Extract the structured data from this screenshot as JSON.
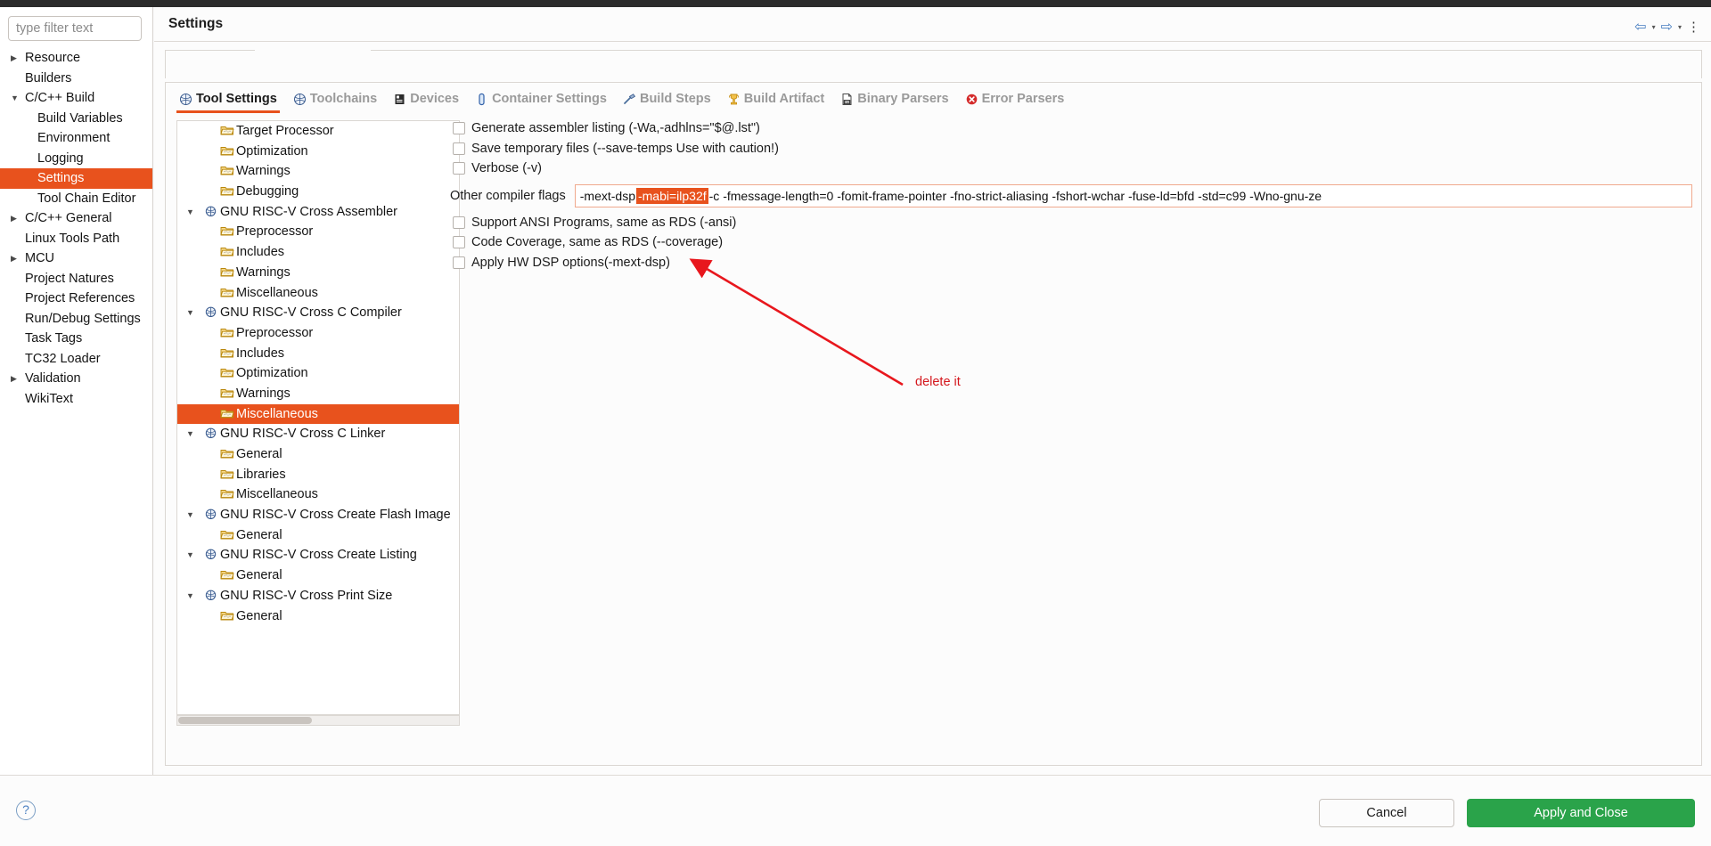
{
  "window": {
    "title": "Settings"
  },
  "sidebar": {
    "filter_placeholder": "type filter text",
    "items": [
      {
        "label": "Resource",
        "twisty": "collapsed",
        "indent": 0,
        "selected": false
      },
      {
        "label": "Builders",
        "twisty": "none",
        "indent": 0,
        "selected": false
      },
      {
        "label": "C/C++ Build",
        "twisty": "expanded",
        "indent": 0,
        "selected": false
      },
      {
        "label": "Build Variables",
        "twisty": "none",
        "indent": 1,
        "selected": false
      },
      {
        "label": "Environment",
        "twisty": "none",
        "indent": 1,
        "selected": false
      },
      {
        "label": "Logging",
        "twisty": "none",
        "indent": 1,
        "selected": false
      },
      {
        "label": "Settings",
        "twisty": "none",
        "indent": 1,
        "selected": true
      },
      {
        "label": "Tool Chain Editor",
        "twisty": "none",
        "indent": 1,
        "selected": false
      },
      {
        "label": "C/C++ General",
        "twisty": "collapsed",
        "indent": 0,
        "selected": false
      },
      {
        "label": "Linux Tools Path",
        "twisty": "none",
        "indent": 0,
        "selected": false
      },
      {
        "label": "MCU",
        "twisty": "collapsed",
        "indent": 0,
        "selected": false
      },
      {
        "label": "Project Natures",
        "twisty": "none",
        "indent": 0,
        "selected": false
      },
      {
        "label": "Project References",
        "twisty": "none",
        "indent": 0,
        "selected": false
      },
      {
        "label": "Run/Debug Settings",
        "twisty": "none",
        "indent": 0,
        "selected": false
      },
      {
        "label": "Task Tags",
        "twisty": "none",
        "indent": 0,
        "selected": false
      },
      {
        "label": "TC32 Loader",
        "twisty": "none",
        "indent": 0,
        "selected": false
      },
      {
        "label": "Validation",
        "twisty": "collapsed",
        "indent": 0,
        "selected": false
      },
      {
        "label": "WikiText",
        "twisty": "none",
        "indent": 0,
        "selected": false
      }
    ]
  },
  "header": {
    "title": "Settings",
    "nav_back": "⇦",
    "nav_back_caret": "▾",
    "nav_forward": "⇨",
    "nav_forward_caret": "▾",
    "menu": "⋮"
  },
  "tabs": [
    {
      "label": "Tool Settings",
      "icon": "wrench-gear-icon",
      "active": true
    },
    {
      "label": "Toolchains",
      "icon": "wrench-gear-icon",
      "active": false
    },
    {
      "label": "Devices",
      "icon": "chip-icon",
      "active": false
    },
    {
      "label": "Container Settings",
      "icon": "container-icon",
      "active": false
    },
    {
      "label": "Build Steps",
      "icon": "hammer-icon",
      "active": false
    },
    {
      "label": "Build Artifact",
      "icon": "trophy-icon",
      "active": false
    },
    {
      "label": "Binary Parsers",
      "icon": "binary-file-icon",
      "active": false
    },
    {
      "label": "Error Parsers",
      "icon": "error-circle-icon",
      "active": false
    }
  ],
  "tool_tree": [
    {
      "label": "Target Processor",
      "twisty": "none",
      "level": 1,
      "selected": false
    },
    {
      "label": "Optimization",
      "twisty": "none",
      "level": 1,
      "selected": false
    },
    {
      "label": "Warnings",
      "twisty": "none",
      "level": 1,
      "selected": false
    },
    {
      "label": "Debugging",
      "twisty": "none",
      "level": 1,
      "selected": false
    },
    {
      "label": "GNU RISC-V Cross Assembler",
      "twisty": "expanded",
      "level": 0,
      "selected": false
    },
    {
      "label": "Preprocessor",
      "twisty": "none",
      "level": 1,
      "selected": false
    },
    {
      "label": "Includes",
      "twisty": "none",
      "level": 1,
      "selected": false
    },
    {
      "label": "Warnings",
      "twisty": "none",
      "level": 1,
      "selected": false
    },
    {
      "label": "Miscellaneous",
      "twisty": "none",
      "level": 1,
      "selected": false
    },
    {
      "label": "GNU RISC-V Cross C Compiler",
      "twisty": "expanded",
      "level": 0,
      "selected": false
    },
    {
      "label": "Preprocessor",
      "twisty": "none",
      "level": 1,
      "selected": false
    },
    {
      "label": "Includes",
      "twisty": "none",
      "level": 1,
      "selected": false
    },
    {
      "label": "Optimization",
      "twisty": "none",
      "level": 1,
      "selected": false
    },
    {
      "label": "Warnings",
      "twisty": "none",
      "level": 1,
      "selected": false
    },
    {
      "label": "Miscellaneous",
      "twisty": "none",
      "level": 1,
      "selected": true
    },
    {
      "label": "GNU RISC-V Cross C Linker",
      "twisty": "expanded",
      "level": 0,
      "selected": false
    },
    {
      "label": "General",
      "twisty": "none",
      "level": 1,
      "selected": false
    },
    {
      "label": "Libraries",
      "twisty": "none",
      "level": 1,
      "selected": false
    },
    {
      "label": "Miscellaneous",
      "twisty": "none",
      "level": 1,
      "selected": false
    },
    {
      "label": "GNU RISC-V Cross Create Flash Image",
      "twisty": "expanded",
      "level": 0,
      "selected": false
    },
    {
      "label": "General",
      "twisty": "none",
      "level": 1,
      "selected": false
    },
    {
      "label": "GNU RISC-V Cross Create Listing",
      "twisty": "expanded",
      "level": 0,
      "selected": false
    },
    {
      "label": "General",
      "twisty": "none",
      "level": 1,
      "selected": false
    },
    {
      "label": "GNU RISC-V Cross Print Size",
      "twisty": "expanded",
      "level": 0,
      "selected": false
    },
    {
      "label": "General",
      "twisty": "none",
      "level": 1,
      "selected": false
    }
  ],
  "options": {
    "checkboxes_top": [
      {
        "label": "Generate assembler listing (-Wa,-adhlns=\"$@.lst\")",
        "checked": false
      },
      {
        "label": "Save temporary files (--save-temps Use with caution!)",
        "checked": false
      },
      {
        "label": "Verbose (-v)",
        "checked": false
      }
    ],
    "flags": {
      "label": "Other compiler flags",
      "prefix": "-mext-dsp ",
      "highlighted": "-mabi=ilp32f",
      "suffix": " -c -fmessage-length=0  -fomit-frame-pointer -fno-strict-aliasing -fshort-wchar -fuse-ld=bfd -std=c99 -Wno-gnu-ze"
    },
    "checkboxes_bottom": [
      {
        "label": "Support ANSI Programs, same as RDS (-ansi)",
        "checked": false
      },
      {
        "label": "Code Coverage, same as RDS (--coverage)",
        "checked": false
      },
      {
        "label": "Apply HW DSP options(-mext-dsp)",
        "checked": false
      }
    ]
  },
  "annotation": {
    "text": "delete it",
    "color": "#d4161c"
  },
  "footer": {
    "help": "?",
    "cancel_label": "Cancel",
    "apply_label": "Apply and Close"
  }
}
